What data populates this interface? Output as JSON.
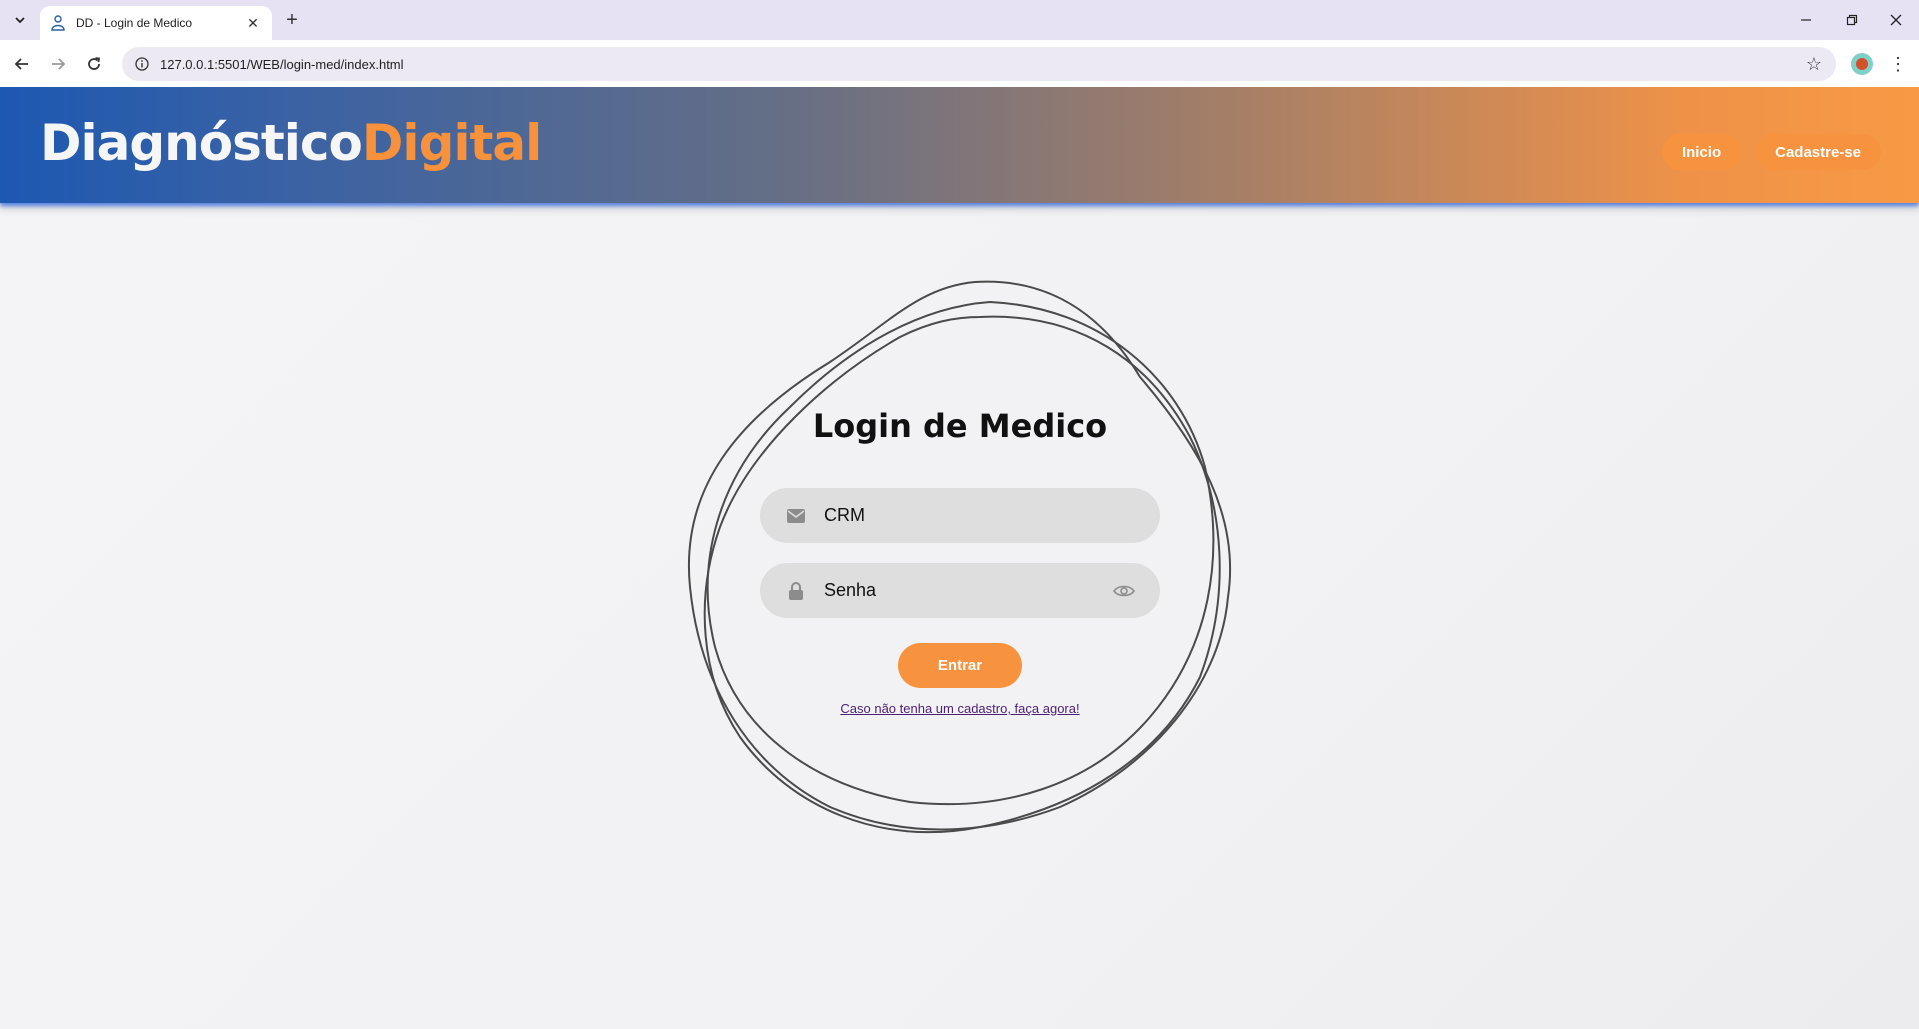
{
  "browser": {
    "tab_title": "DD - Login de Medico",
    "new_tab_label": "+",
    "url": "127.0.0.1:5501/WEB/login-med/index.html"
  },
  "header": {
    "logo_part1": "Diagnóstico",
    "logo_part2": "Digital",
    "nav": {
      "home_label": "Inicio",
      "signup_label": "Cadastre-se"
    }
  },
  "login": {
    "title": "Login de Medico",
    "crm_placeholder": "CRM",
    "password_placeholder": "Senha",
    "submit_label": "Entrar",
    "signup_link": "Caso não tenha um cadastro, faça agora!"
  },
  "colors": {
    "accent": "#f7923e",
    "header_start": "#1d58b2",
    "header_end": "#f89a44",
    "link": "#4b1f73"
  }
}
